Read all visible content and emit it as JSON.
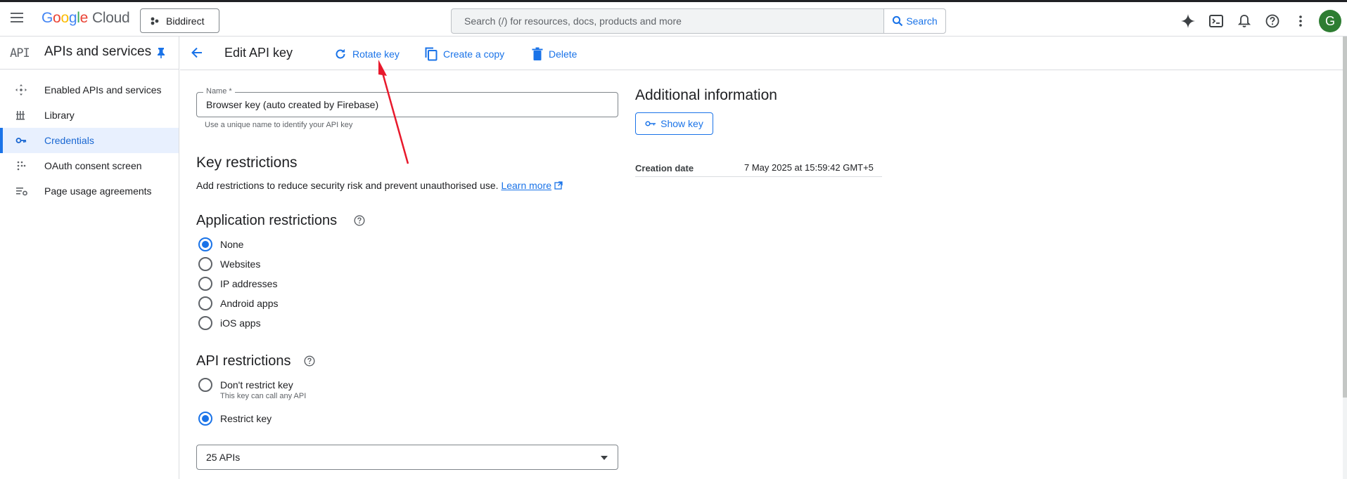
{
  "topbar": {
    "logo_google": [
      "G",
      "o",
      "o",
      "g",
      "l",
      "e"
    ],
    "logo_cloud": "Cloud",
    "project_name": "Biddirect",
    "search_placeholder": "Search (/) for resources, docs, products and more",
    "search_button": "Search",
    "avatar_letter": "G",
    "icons": [
      "gemini-icon",
      "cloud-shell-icon",
      "notifications-icon",
      "help-icon",
      "more-vert-icon"
    ]
  },
  "sidebar": {
    "badge": "API",
    "title": "APIs and services",
    "items": [
      {
        "label": "Enabled APIs and services",
        "icon": "enabled-apis-icon"
      },
      {
        "label": "Library",
        "icon": "library-icon"
      },
      {
        "label": "Credentials",
        "icon": "key-icon",
        "active": true
      },
      {
        "label": "OAuth consent screen",
        "icon": "oauth-icon"
      },
      {
        "label": "Page usage agreements",
        "icon": "settings-list-icon"
      }
    ]
  },
  "header": {
    "title": "Edit API key",
    "actions": {
      "rotate": "Rotate key",
      "copy": "Create a copy",
      "delete": "Delete"
    }
  },
  "form": {
    "name_label": "Name *",
    "name_value": "Browser key (auto created by Firebase)",
    "name_hint": "Use a unique name to identify your API key",
    "key_restrictions_title": "Key restrictions",
    "key_restrictions_desc": "Add restrictions to reduce security risk and prevent unauthorised use.",
    "learn_more": "Learn more",
    "app_restrictions_title": "Application restrictions",
    "app_options": [
      {
        "label": "None",
        "selected": true
      },
      {
        "label": "Websites",
        "selected": false
      },
      {
        "label": "IP addresses",
        "selected": false
      },
      {
        "label": "Android apps",
        "selected": false
      },
      {
        "label": "iOS apps",
        "selected": false
      }
    ],
    "api_restrictions_title": "API restrictions",
    "api_options": [
      {
        "label": "Don't restrict key",
        "sub": "This key can call any API",
        "selected": false
      },
      {
        "label": "Restrict key",
        "selected": true
      }
    ],
    "api_select_value": "25 APIs"
  },
  "info": {
    "title": "Additional information",
    "show_key": "Show key",
    "creation_label": "Creation date",
    "creation_value": "7 May 2025 at 15:59:42 GMT+5"
  },
  "colors": {
    "accent": "#1a73e8",
    "active_bg": "#e8f0fe",
    "annotation": "#e8192c",
    "avatar": "#2e7d32"
  }
}
